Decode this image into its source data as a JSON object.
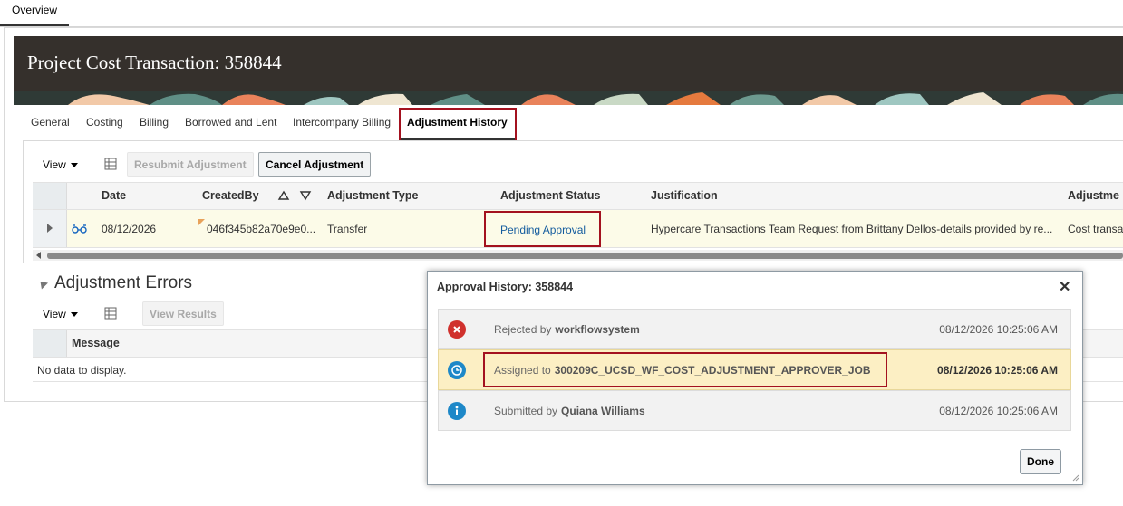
{
  "page_tab": "Overview",
  "header": {
    "title": "Project Cost Transaction: 358844"
  },
  "detail_tabs": [
    {
      "label": "General"
    },
    {
      "label": "Costing"
    },
    {
      "label": "Billing"
    },
    {
      "label": "Borrowed and Lent"
    },
    {
      "label": "Intercompany Billing"
    },
    {
      "label": "Adjustment History"
    }
  ],
  "adjustment_toolbar": {
    "view_label": "View",
    "resubmit_label": "Resubmit Adjustment",
    "cancel_label": "Cancel Adjustment"
  },
  "adjustment_table": {
    "columns": [
      "Date",
      "CreatedBy",
      "Adjustment Type",
      "Adjustment Status",
      "Justification",
      "Adjustme"
    ],
    "rows": [
      {
        "date": "08/12/2026",
        "created_by": "046f345b82a70e9e0...",
        "type": "Transfer",
        "status": "Pending Approval",
        "justification": "Hypercare Transactions Team Request from Brittany Dellos-details provided by re...",
        "adjustment": "Cost transa"
      }
    ]
  },
  "errors_section": {
    "title": "Adjustment Errors",
    "view_label": "View",
    "view_results_label": "View Results",
    "column": "Message",
    "empty_text": "No data to display."
  },
  "dialog": {
    "title": "Approval History: 358844",
    "close_glyph": "✕",
    "entries": [
      {
        "action": "Rejected by",
        "actor": "workflowsystem",
        "timestamp": "08/12/2026 10:25:06 AM",
        "icon": "error-icon",
        "color": "#d0312d"
      },
      {
        "action": "Assigned to",
        "actor": "300209C_UCSD_WF_COST_ADJUSTMENT_APPROVER_JOB",
        "timestamp": "08/12/2026 10:25:06 AM",
        "icon": "clock-icon",
        "color": "#1e88c8"
      },
      {
        "action": "Submitted by",
        "actor": "Quiana Williams",
        "timestamp": "08/12/2026 10:25:06 AM",
        "icon": "info-icon",
        "color": "#1e88c8"
      }
    ],
    "done_label": "Done"
  }
}
